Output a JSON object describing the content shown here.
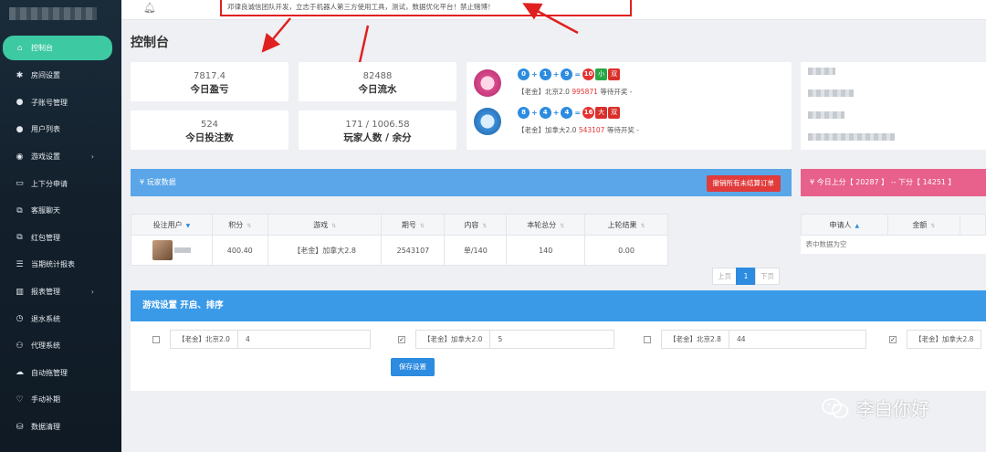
{
  "sidebar": {
    "items": [
      {
        "label": "控制台",
        "icon": "home-icon"
      },
      {
        "label": "房间设置",
        "icon": "gear-icon"
      },
      {
        "label": "子账号管理",
        "icon": "user-icon"
      },
      {
        "label": "用户列表",
        "icon": "user-icon"
      },
      {
        "label": "游戏设置",
        "icon": "gamepad-icon",
        "arrow": true
      },
      {
        "label": "上下分申请",
        "icon": "card-icon"
      },
      {
        "label": "客服聊天",
        "icon": "external-icon"
      },
      {
        "label": "红包管理",
        "icon": "external-icon"
      },
      {
        "label": "当期统计报表",
        "icon": "list-icon"
      },
      {
        "label": "报表管理",
        "icon": "chart-icon",
        "arrow": true
      },
      {
        "label": "退水系统",
        "icon": "clock-icon"
      },
      {
        "label": "代理系统",
        "icon": "users-icon"
      },
      {
        "label": "自动拖管理",
        "icon": "cloud-icon"
      },
      {
        "label": "手动补期",
        "icon": "heart-icon"
      },
      {
        "label": "数据清理",
        "icon": "database-icon"
      }
    ]
  },
  "header": {
    "notice": "邓律良诚信团队开发，立志于机器人第三方使用工具，测试，数据优化平台！禁止赌博！"
  },
  "page_title": "控制台",
  "stats": {
    "profit": {
      "value": "7817.4",
      "label": "今日盈亏"
    },
    "flow": {
      "value": "82488",
      "label": "今日流水"
    },
    "bets": {
      "value": "524",
      "label": "今日投注数"
    },
    "players": {
      "value": "171 / 1006.58",
      "label": "玩家人数 / 余分"
    }
  },
  "lottery": [
    {
      "balls": [
        "0",
        "1",
        "9"
      ],
      "sum": "10",
      "size": "小",
      "parity": "双",
      "name": "【老金】北京2.0",
      "issue": "995871",
      "status": "等待开奖 -"
    },
    {
      "balls": [
        "8",
        "4",
        "4"
      ],
      "sum": "16",
      "size": "大",
      "parity": "双",
      "name": "【老金】加拿大2.0",
      "issue": "543107",
      "status": "等待开奖 -"
    }
  ],
  "player_panel": {
    "title": "¥ 玩家数据",
    "cancel_button": "撤销所有未结算订单",
    "columns": [
      "投注用户",
      "积分",
      "游戏",
      "期号",
      "内容",
      "本轮总分",
      "上轮结果"
    ],
    "rows": [
      [
        "",
        "400.40",
        "【老金】加拿大2.8",
        "2543107",
        "单/140",
        "140",
        "0.00"
      ]
    ]
  },
  "apply_panel": {
    "title": "¥ 今日上分【 20287 】 -- 下分【 14251 】",
    "columns": [
      "申请人",
      "金额"
    ],
    "empty_text": "表中数据为空"
  },
  "pagination": {
    "prev": "上页",
    "current": "1",
    "next": "下页"
  },
  "game_settings": {
    "title": "游戏设置 开启、排序",
    "items": [
      {
        "checked": false,
        "name": "【老金】北京2.0",
        "value": "4"
      },
      {
        "checked": true,
        "name": "【老金】加拿大2.0",
        "value": "5"
      },
      {
        "checked": false,
        "name": "【老金】北京2.8",
        "value": "44"
      },
      {
        "checked": true,
        "name": "【老金】加拿大2.8",
        "value": ""
      }
    ],
    "save_button": "保存设置"
  },
  "watermark": "李白你好",
  "colors": {
    "accent": "#3dcaa3",
    "blue": "#5aa6e8",
    "pink": "#e8608c",
    "danger": "#e13b3b"
  }
}
